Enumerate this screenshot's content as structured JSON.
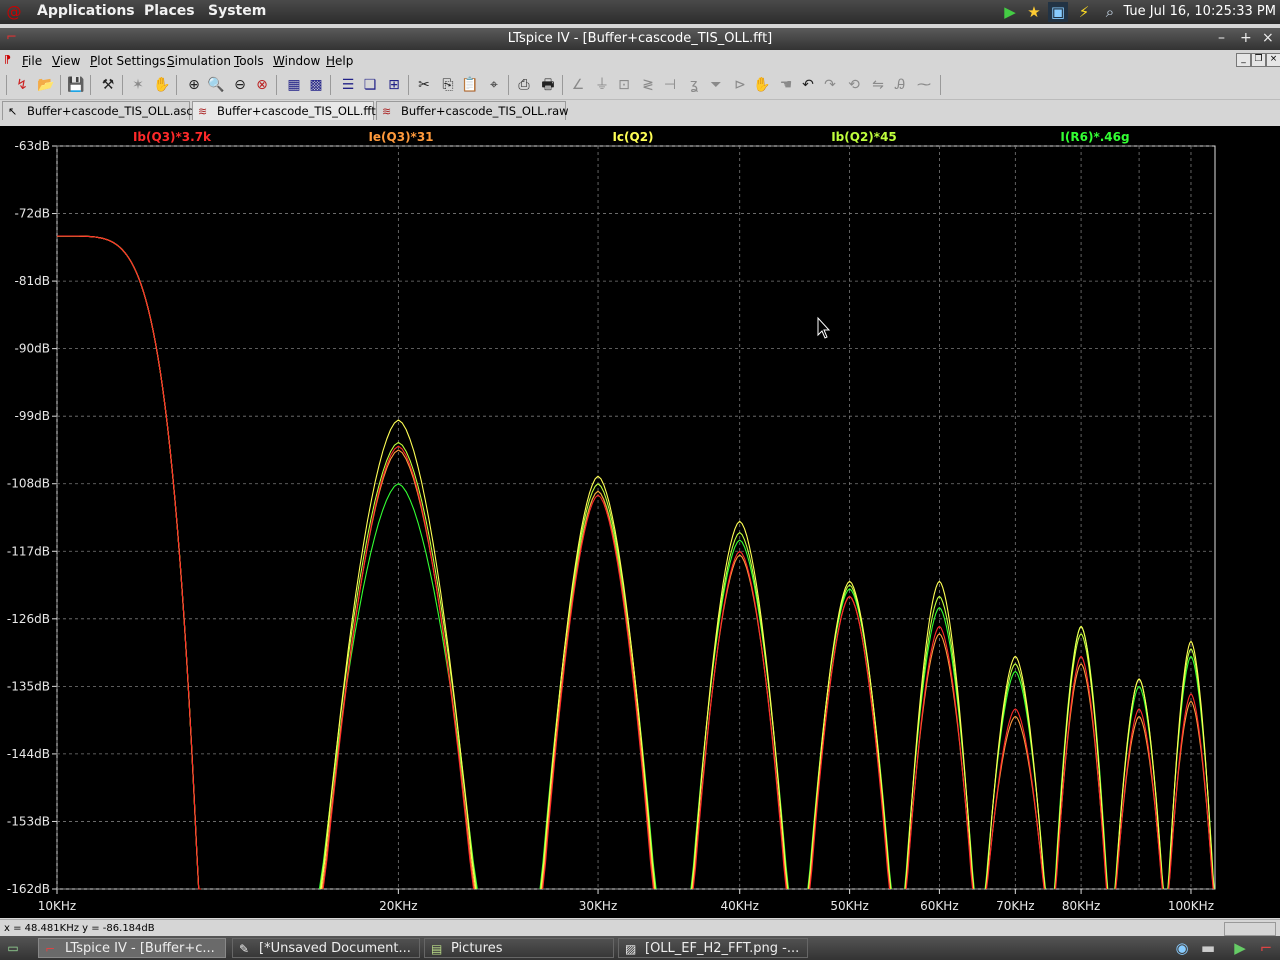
{
  "top_panel": {
    "menus": [
      "Applications",
      "Places",
      "System"
    ],
    "clock": "Tue Jul 16, 10:25:33 PM"
  },
  "window": {
    "title": "LTspice IV - [Buffer+cascode_TIS_OLL.fft]"
  },
  "menubar": [
    "File",
    "View",
    "Plot Settings",
    "Simulation",
    "Tools",
    "Window",
    "Help"
  ],
  "tabs": [
    {
      "label": "Buffer+cascode_TIS_OLL.asc"
    },
    {
      "label": "Buffer+cascode_TIS_OLL.fft"
    },
    {
      "label": "Buffer+cascode_TIS_OLL.raw"
    }
  ],
  "status": {
    "cursor": "x = 48.481KHz    y = -86.184dB"
  },
  "taskbar": [
    {
      "label": "LTspice IV - [Buffer+c..."
    },
    {
      "label": "[*Unsaved Document..."
    },
    {
      "label": "Pictures"
    },
    {
      "label": "[OLL_EF_H2_FFT.png -..."
    }
  ],
  "chart_data": {
    "type": "line",
    "scale": "log-x",
    "grid": true,
    "legend": "top",
    "xlim": [
      10000,
      105000
    ],
    "ylim": [
      -162,
      -63
    ],
    "x_ticks": [
      {
        "value": 10000,
        "label": "10KHz"
      },
      {
        "value": 20000,
        "label": "20KHz"
      },
      {
        "value": 30000,
        "label": "30KHz"
      },
      {
        "value": 40000,
        "label": "40KHz"
      },
      {
        "value": 50000,
        "label": "50KHz"
      },
      {
        "value": 60000,
        "label": "60KHz"
      },
      {
        "value": 70000,
        "label": "70KHz"
      },
      {
        "value": 80000,
        "label": "80KHz"
      },
      {
        "value": 100000,
        "label": "100KHz"
      }
    ],
    "y_ticks": [
      {
        "value": -63,
        "label": "-63dB"
      },
      {
        "value": -72,
        "label": "-72dB"
      },
      {
        "value": -81,
        "label": "-81dB"
      },
      {
        "value": -90,
        "label": "-90dB"
      },
      {
        "value": -99,
        "label": "-99dB"
      },
      {
        "value": -108,
        "label": "-108dB"
      },
      {
        "value": -117,
        "label": "-117dB"
      },
      {
        "value": -126,
        "label": "-126dB"
      },
      {
        "value": -135,
        "label": "-135dB"
      },
      {
        "value": -144,
        "label": "-144dB"
      },
      {
        "value": -153,
        "label": "-153dB"
      },
      {
        "value": -162,
        "label": "-162dB"
      }
    ],
    "peak_frequencies": [
      20000,
      30000,
      40000,
      50000,
      60000,
      70000,
      80000,
      90000,
      100000
    ],
    "series": [
      {
        "name": "Ib(Q3)*3.7k",
        "color": "#ff2a2a",
        "peaks": [
          -103,
          -109.5,
          -117,
          -123,
          -127,
          -138,
          -131,
          -138,
          -136
        ]
      },
      {
        "name": "Ie(Q3)*31",
        "color": "#ff9a3c",
        "peaks": [
          -103.5,
          -109,
          -117.5,
          -123,
          -128,
          -139,
          -132,
          -139,
          -137
        ]
      },
      {
        "name": "Ic(Q2)",
        "color": "#ffff55",
        "peaks": [
          -99.5,
          -107,
          -113,
          -121,
          -121,
          -131,
          -127,
          -134,
          -129
        ]
      },
      {
        "name": "Ib(Q2)*45",
        "color": "#bfff3c",
        "peaks": [
          -102.5,
          -108,
          -114.5,
          -121.5,
          -123,
          -132,
          -128,
          -134,
          -130
        ]
      },
      {
        "name": "I(R6)*.46g",
        "color": "#33ff33",
        "peaks": [
          -108,
          -109,
          -115.5,
          -122,
          -124.5,
          -133,
          -127,
          -135,
          -131
        ]
      }
    ],
    "low_freq_start": -75
  }
}
